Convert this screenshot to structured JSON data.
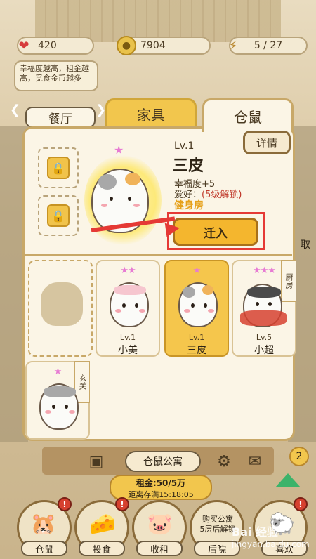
{
  "stats": {
    "hearts": "420",
    "coins": "7904",
    "energy": "5 / 27"
  },
  "notice": "幸福度越高，租金越高，觅食金币越多",
  "tabs": {
    "restaurant": "餐厅",
    "furniture": "家具",
    "hamster": "仓鼠"
  },
  "detail_button": "详情",
  "selected_hamster": {
    "level": "Lv.1",
    "name": "三皮",
    "happiness": "幸福度+5",
    "hobby_label": "爱好：",
    "hobby_lock": "(5级解锁)",
    "hobby_value": "健身房",
    "move_in_button": "迁入"
  },
  "cards": [
    {
      "level": "Lv.1",
      "name": "小美",
      "stars": "★★"
    },
    {
      "level": "Lv.1",
      "name": "三皮",
      "stars": "★"
    },
    {
      "level": "Lv.5",
      "name": "小超",
      "stars": "★★★",
      "ribbon": "厨房"
    },
    {
      "stars": "★",
      "ribbon": "玄关"
    }
  ],
  "apartment_button": "仓鼠公寓",
  "badge_count": "2",
  "rent": {
    "line1": "租金:50/5万",
    "line2": "距离存满15:18:05"
  },
  "nav": {
    "hamster": "仓鼠",
    "feed": "投食",
    "rent": "收租",
    "backyard": "后院",
    "buy": "购买公寓",
    "buy_note": "5层后解锁",
    "like": "喜欢"
  },
  "side": {
    "right_text": "取"
  },
  "watermark": {
    "main": "Bai 经验",
    "sub": "jingyan.baidu.com"
  }
}
